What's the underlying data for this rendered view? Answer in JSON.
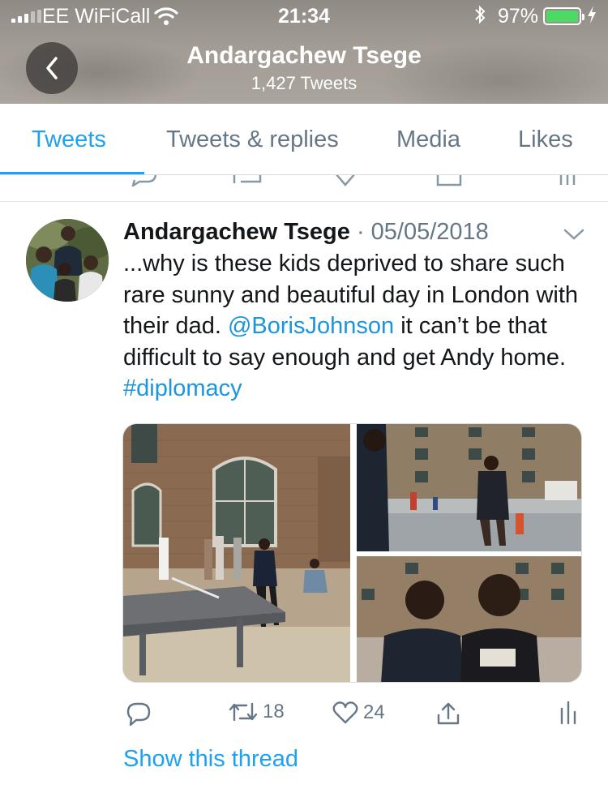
{
  "status_bar": {
    "carrier": "EE WiFiCall",
    "time": "21:34",
    "battery": "97%",
    "battery_level": 0.97
  },
  "header": {
    "name": "Andargachew Tsege",
    "tweet_count": "1,427 Tweets"
  },
  "tabs": [
    {
      "label": "Tweets",
      "active": true
    },
    {
      "label": "Tweets & replies",
      "active": false
    },
    {
      "label": "Media",
      "active": false
    },
    {
      "label": "Likes",
      "active": false
    }
  ],
  "tweet": {
    "author": "Andargachew Tsege",
    "separator": " · ",
    "date": "05/05/2018",
    "text_part1": "...why is these kids deprived  to share such rare sunny and beautiful day in London with their dad. ",
    "mention": "@BorisJohnson",
    "text_part2": " it can’t be that difficult to say enough and get Andy home. ",
    "hashtag": "#diplomacy",
    "retweets": "18",
    "likes": "24",
    "show_thread": "Show this thread"
  },
  "colors": {
    "accent": "#1da1f2",
    "link": "#1b95e0",
    "muted": "#657786",
    "battery": "#4cd964"
  },
  "icons": [
    "back-icon",
    "wifi-icon",
    "bluetooth-icon",
    "reply-icon",
    "retweet-icon",
    "heart-icon",
    "share-icon",
    "analytics-icon",
    "chevron-down-icon"
  ]
}
